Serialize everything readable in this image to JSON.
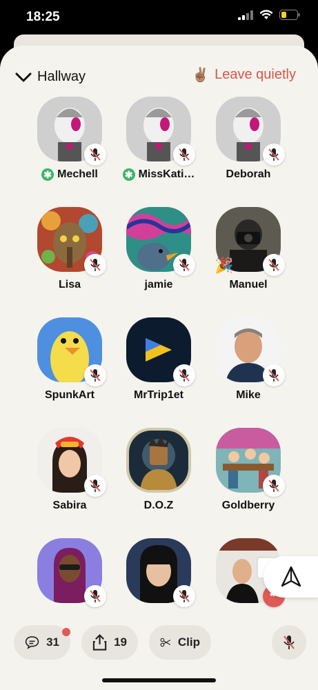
{
  "status": {
    "time": "18:25"
  },
  "header": {
    "room_title": "Hallway",
    "leave_label": "Leave quietly",
    "leave_emoji": "✌🏽"
  },
  "people": [
    {
      "name": "Mechell",
      "moderator": true
    },
    {
      "name": "MissKati…",
      "moderator": true
    },
    {
      "name": "Deborah",
      "moderator": false
    },
    {
      "name": "Lisa",
      "moderator": false
    },
    {
      "name": "jamie",
      "moderator": false
    },
    {
      "name": "Manuel",
      "moderator": false,
      "emoji": "🎉"
    },
    {
      "name": "SpunkArt",
      "moderator": false
    },
    {
      "name": "MrTrip1et",
      "moderator": false
    },
    {
      "name": "Mike",
      "moderator": false
    },
    {
      "name": "Sabira",
      "moderator": false
    },
    {
      "name": "D.O.Z",
      "moderator": false
    },
    {
      "name": "Goldberry",
      "moderator": false
    },
    {
      "name": "",
      "moderator": false
    },
    {
      "name": "",
      "moderator": false
    },
    {
      "name": "",
      "moderator": false
    }
  ],
  "bottom": {
    "chat_count": "31",
    "share_count": "19",
    "clip_label": "Clip"
  },
  "colors": {
    "accent_red": "#d9544b",
    "moderator_green": "#3fb36a",
    "sheet_bg": "#f4f3ee"
  }
}
